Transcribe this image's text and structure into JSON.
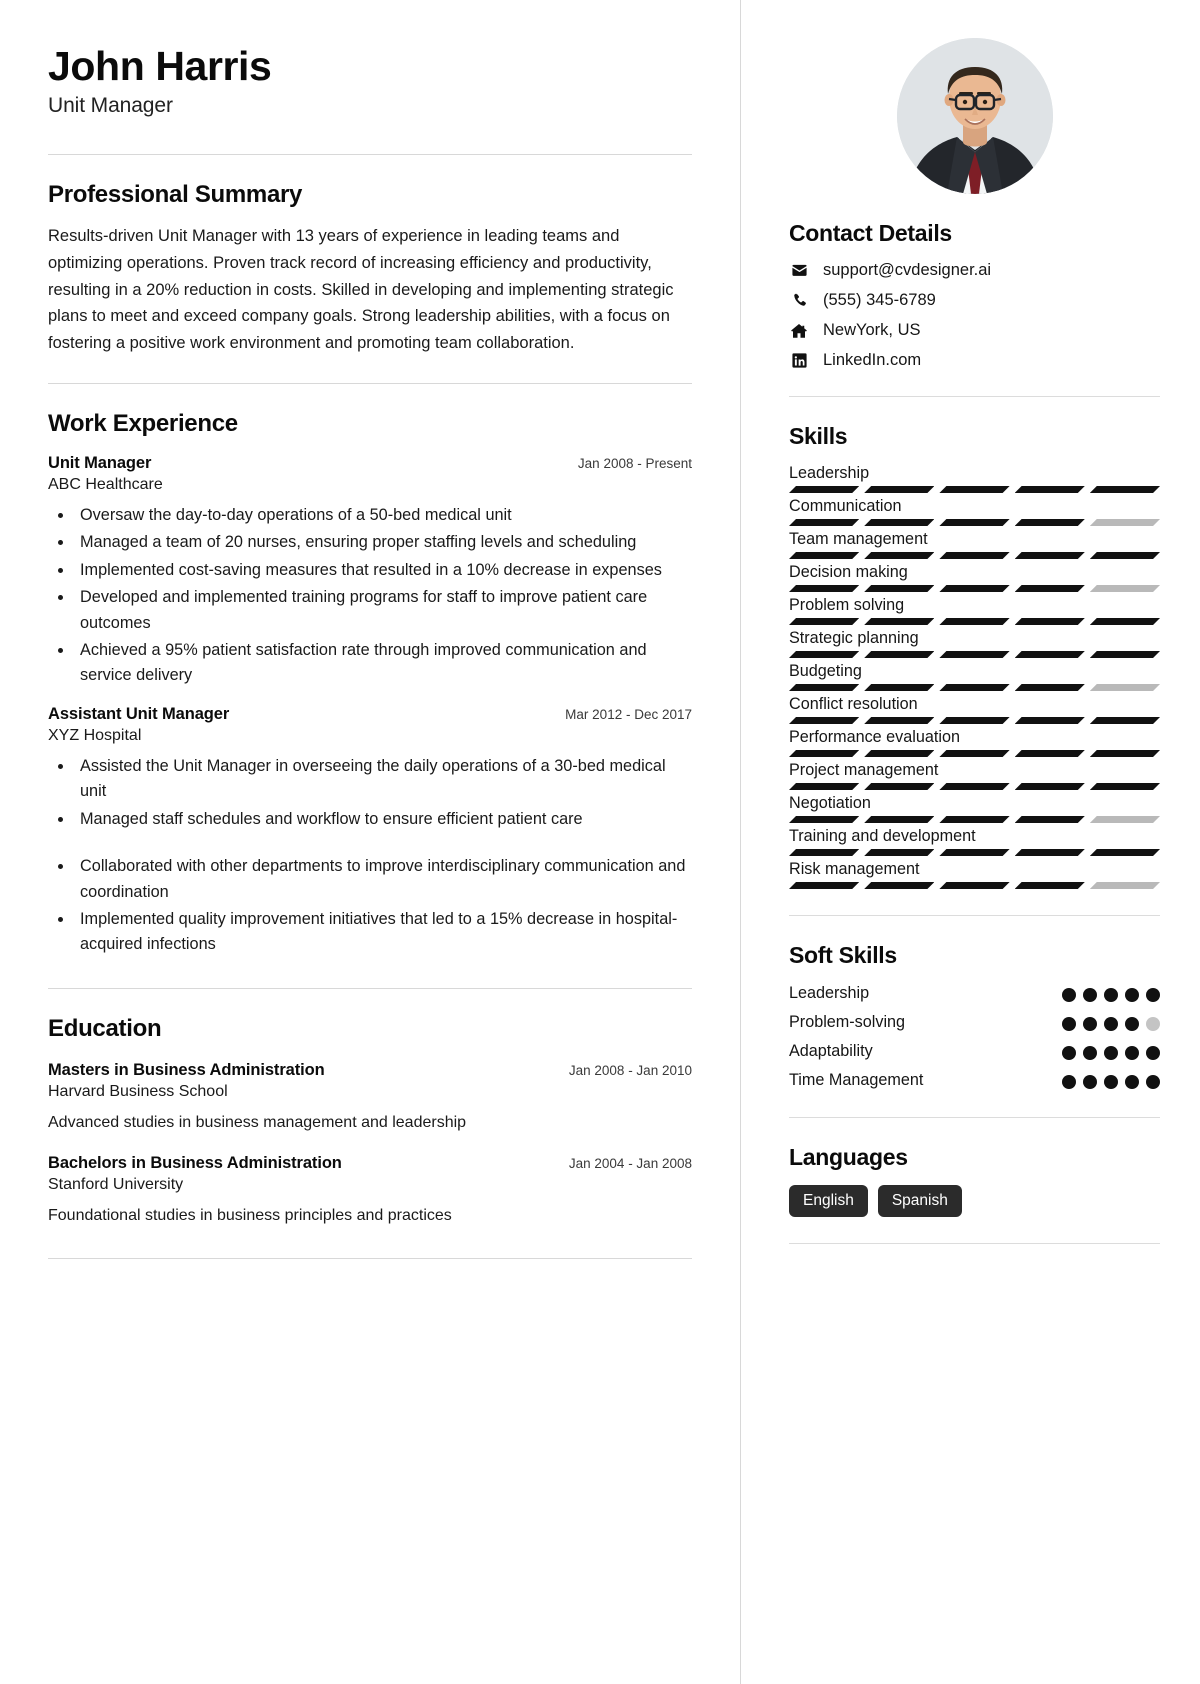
{
  "header": {
    "name": "John Harris",
    "job_title": "Unit Manager"
  },
  "summary": {
    "title": "Professional Summary",
    "text": "Results-driven Unit Manager with 13 years of experience in leading teams and optimizing operations. Proven track record of increasing efficiency and productivity, resulting in a 20% reduction in costs. Skilled in developing and implementing strategic plans to meet and exceed company goals. Strong leadership abilities, with a focus on fostering a positive work environment and promoting team collaboration."
  },
  "work": {
    "title": "Work Experience",
    "entries": [
      {
        "role": "Unit Manager",
        "date": "Jan 2008 - Present",
        "org": "ABC Healthcare",
        "bullets": [
          "Oversaw the day-to-day operations of a 50-bed medical unit",
          "Managed a team of 20 nurses, ensuring proper staffing levels and scheduling",
          "Implemented cost-saving measures that resulted in a 10% decrease in expenses",
          "Developed and implemented training programs for staff to improve patient care outcomes",
          "Achieved a 95% patient satisfaction rate through improved communication and service delivery"
        ]
      },
      {
        "role": "Assistant Unit Manager",
        "date": "Mar 2012 - Dec 2017",
        "org": "XYZ Hospital",
        "bullets": [
          "Assisted the Unit Manager in overseeing the daily operations of a 30-bed medical unit",
          "Managed staff schedules and workflow to ensure efficient patient care",
          "Collaborated with other departments to improve interdisciplinary communication and coordination",
          "Implemented quality improvement initiatives that led to a 15% decrease in hospital-acquired infections"
        ]
      }
    ]
  },
  "education": {
    "title": "Education",
    "entries": [
      {
        "degree": "Masters in Business Administration",
        "date": "Jan 2008 - Jan 2010",
        "school": "Harvard Business School",
        "desc": "Advanced studies in business management and leadership"
      },
      {
        "degree": "Bachelors in Business Administration",
        "date": "Jan 2004 - Jan 2008",
        "school": "Stanford University",
        "desc": "Foundational studies in business principles and practices"
      }
    ]
  },
  "contact": {
    "title": "Contact Details",
    "items": [
      {
        "icon": "envelope-icon",
        "value": "support@cvdesigner.ai"
      },
      {
        "icon": "phone-icon",
        "value": "(555) 345-6789"
      },
      {
        "icon": "home-icon",
        "value": "NewYork, US"
      },
      {
        "icon": "linkedin-icon",
        "value": "LinkedIn.com"
      }
    ]
  },
  "skills": {
    "title": "Skills",
    "max_segments": 5,
    "items": [
      {
        "label": "Leadership",
        "level": 5
      },
      {
        "label": "Communication",
        "level": 4
      },
      {
        "label": "Team management",
        "level": 5
      },
      {
        "label": "Decision making",
        "level": 4
      },
      {
        "label": "Problem solving",
        "level": 5
      },
      {
        "label": "Strategic planning",
        "level": 5
      },
      {
        "label": "Budgeting",
        "level": 4
      },
      {
        "label": "Conflict resolution",
        "level": 5
      },
      {
        "label": "Performance evaluation",
        "level": 5
      },
      {
        "label": "Project management",
        "level": 5
      },
      {
        "label": "Negotiation",
        "level": 4
      },
      {
        "label": "Training and development",
        "level": 5
      },
      {
        "label": "Risk management",
        "level": 4
      }
    ]
  },
  "soft_skills": {
    "title": "Soft Skills",
    "max_dots": 5,
    "items": [
      {
        "label": "Leadership",
        "level": 5
      },
      {
        "label": "Problem-solving",
        "level": 4
      },
      {
        "label": "Adaptability",
        "level": 5
      },
      {
        "label": "Time Management",
        "level": 5
      }
    ]
  },
  "languages": {
    "title": "Languages",
    "items": [
      "English",
      "Spanish"
    ]
  },
  "colors": {
    "accent": "#111111",
    "muted_bar": "#b9b9b9",
    "chip_bg": "#2b2b2b",
    "rule": "#d8d8d8"
  }
}
